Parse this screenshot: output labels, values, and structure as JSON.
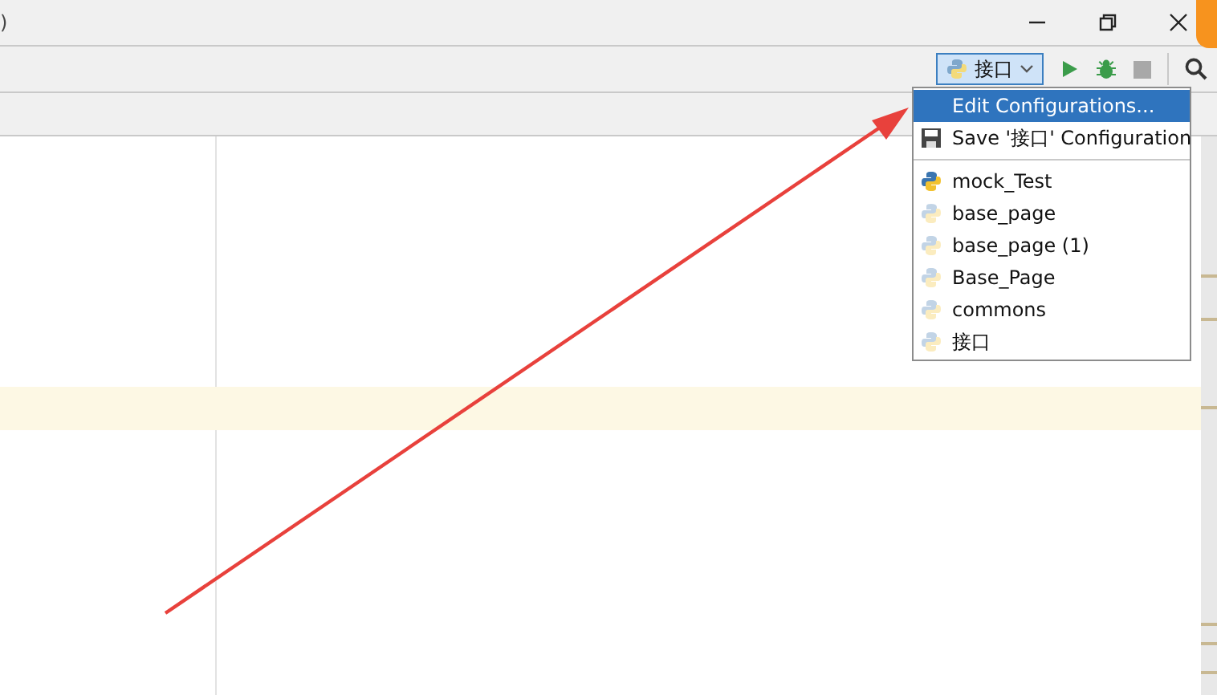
{
  "window": {
    "title": ")"
  },
  "toolbar": {
    "run_config": {
      "label": "接口",
      "expanded": true
    },
    "stop_enabled": false
  },
  "run_menu": {
    "items": [
      {
        "kind": "action",
        "label": "Edit Configurations...",
        "selected": true
      },
      {
        "kind": "save",
        "label": "Save '接口' Configuration",
        "selected": false
      },
      {
        "kind": "separator"
      },
      {
        "kind": "config",
        "label": "mock_Test",
        "temporary": false,
        "selected": false
      },
      {
        "kind": "config",
        "label": "base_page",
        "temporary": true,
        "selected": false
      },
      {
        "kind": "config",
        "label": "base_page (1)",
        "temporary": true,
        "selected": false
      },
      {
        "kind": "config",
        "label": "Base_Page",
        "temporary": true,
        "selected": false
      },
      {
        "kind": "config",
        "label": "commons",
        "temporary": true,
        "selected": false
      },
      {
        "kind": "config",
        "label": "接口",
        "temporary": true,
        "selected": false
      }
    ]
  },
  "annotation": {
    "kind": "arrow",
    "color": "#e8413c"
  }
}
